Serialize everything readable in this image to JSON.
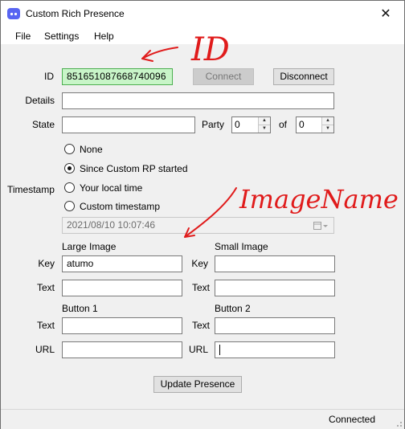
{
  "window": {
    "title": "Custom Rich Presence",
    "close_glyph": "✕"
  },
  "menu": {
    "items": [
      "File",
      "Settings",
      "Help"
    ]
  },
  "form": {
    "id_label": "ID",
    "id_value": "851651087668740096",
    "connect_label": "Connect",
    "disconnect_label": "Disconnect",
    "details_label": "Details",
    "state_label": "State",
    "party_label": "Party",
    "party_value": "0",
    "of_label": "of",
    "of_value": "0",
    "timestamp_label": "Timestamp",
    "radios": [
      "None",
      "Since Custom RP started",
      "Your local time",
      "Custom timestamp"
    ],
    "selected_radio": "Since Custom RP started",
    "datetime_value": "2021/08/10 10:07:46",
    "large_image_header": "Large Image",
    "small_image_header": "Small Image",
    "key_label": "Key",
    "text_label": "Text",
    "large_key_value": "atumo",
    "button1_header": "Button 1",
    "button2_header": "Button 2",
    "url_label": "URL",
    "update_label": "Update Presence"
  },
  "status": {
    "text": "Connected"
  },
  "annotations": {
    "id_note": "ID",
    "image_note": "ImageName",
    "color": "#e01b1b"
  },
  "colors": {
    "id_field_bg": "#c8f5c8",
    "id_field_border": "#4caf50",
    "accent": "#5865f2"
  }
}
